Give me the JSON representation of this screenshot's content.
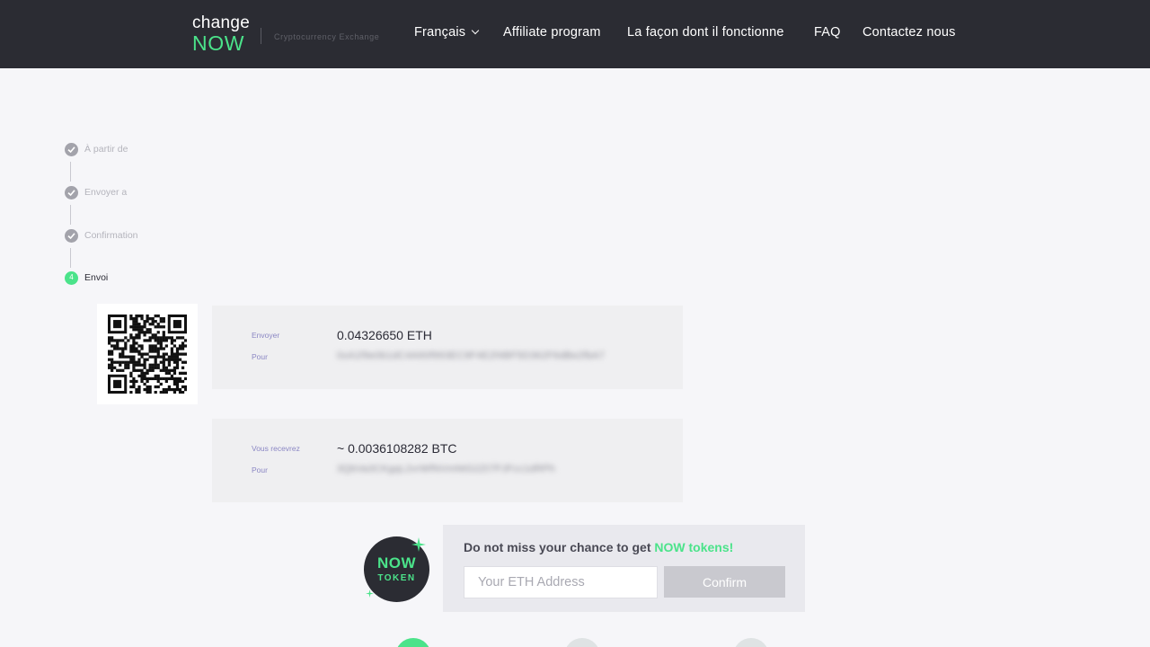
{
  "header": {
    "logo_line1": "change",
    "logo_line2": "NOW",
    "tagline": "Cryptocurrency Exchange",
    "nav": {
      "language": "Français",
      "affiliate": "Affiliate program",
      "how_it_works": "La façon dont il fonctionne",
      "faq": "FAQ",
      "contact": "Contactez nous"
    }
  },
  "steps": [
    {
      "label": "À partir de",
      "state": "done"
    },
    {
      "label": "Envoyer a",
      "state": "done"
    },
    {
      "label": "Confirmation",
      "state": "done"
    },
    {
      "label": "Envoi",
      "state": "active",
      "number": "4"
    }
  ],
  "send": {
    "key": "Envoyer",
    "amount": "0.04326650 ETH",
    "to_key": "Pour",
    "address": "0xA1f9e0b1dC4A90f993EC9F4E2f4BF5D362F6dBe2fbA7"
  },
  "receive": {
    "key": "Vous recevrez",
    "amount": "~ 0.0036108282 BTC",
    "to_key": "Pour",
    "address": "3QbVa3CKgqL2vrWfNVmNtG2Zt7PJFcc1dRPh"
  },
  "promo": {
    "badge_line1": "NOW",
    "badge_line2": "TOKEN",
    "headline_prefix": "Do not miss your chance to get ",
    "headline_highlight": "NOW tokens!",
    "input_placeholder": "Your ETH Address",
    "input_value": "",
    "confirm_label": "Confirm"
  },
  "colors": {
    "accent": "#4be38a",
    "header_bg": "#2b2c33",
    "page_bg": "#f6f6f9",
    "step_done": "#a3a3ab",
    "key_label": "#8b87c4"
  },
  "icons": {
    "step_done": "check-icon",
    "language_dropdown": "chevron-down-icon",
    "qr": "qr-code-icon",
    "sparkle": "sparkle-icon"
  }
}
